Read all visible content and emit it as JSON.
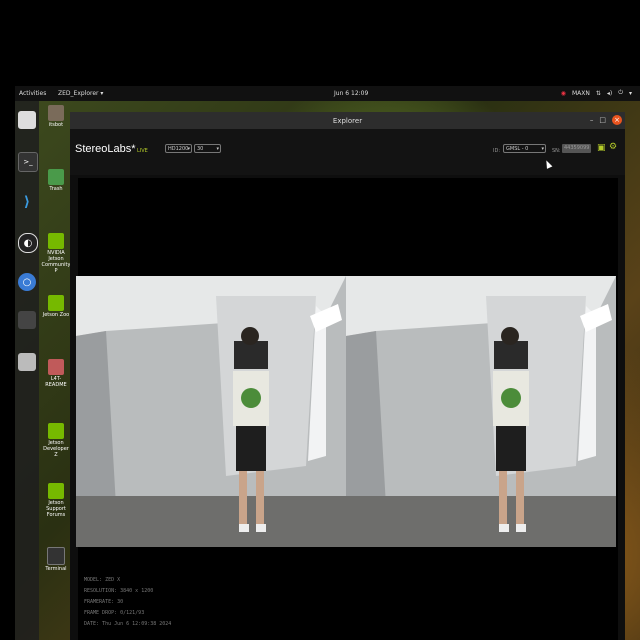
{
  "topbar": {
    "activities": "Activities",
    "app_menu": "ZED_Explorer ▾",
    "clock": "Jun 6 12:09",
    "power_mode": "MAXN",
    "nvidia_icon": "nvidia-icon",
    "network_icon": "network-icon",
    "volume_icon": "volume-icon",
    "power_icon": "power-icon"
  },
  "dock": {
    "items": [
      "files-icon",
      "terminal-icon",
      "vscode-icon",
      "obs-icon",
      "chromium-icon",
      "window-icon",
      "drive-icon"
    ]
  },
  "desktop": {
    "items": [
      {
        "label": "itsbot",
        "icon": "home-folder-icon"
      },
      {
        "label": "Trash",
        "icon": "trash-icon"
      },
      {
        "label": "NVIDIA Jetson Community P",
        "icon": "nvidia-icon"
      },
      {
        "label": "Jetson Zoo",
        "icon": "nvidia-icon"
      },
      {
        "label": "L4T-README",
        "icon": "folder-icon"
      },
      {
        "label": "Jetson Developer Z",
        "icon": "nvidia-icon"
      },
      {
        "label": "Jetson Support Forums",
        "icon": "nvidia-icon"
      },
      {
        "label": "Terminal",
        "icon": "terminal-icon"
      }
    ]
  },
  "window": {
    "title": "Explorer",
    "minimize": "–",
    "maximize": "□",
    "close": "×"
  },
  "toolbar": {
    "brand": "StereoLabs*",
    "mode": "LIVE",
    "resolution_value": "HD1200",
    "fps_value": "30",
    "id_label": "ID:",
    "device_value": "GMSL - 0",
    "sn_label": "SN:",
    "serial_value": "44359099",
    "record_icon": "record-icon",
    "settings_icon": "gear-icon"
  },
  "info": {
    "model": "MODEL: ZED X",
    "resolution": "RESOLUTION: 3840 x 1200",
    "framerate": "FRAMERATE: 30",
    "frame_drop": "FRAME DROP: 0/121/93",
    "date": "DATE: Thu Jun 6 12:09:38 2024"
  },
  "colors": {
    "accent": "#b5cc2a",
    "close": "#e9541f",
    "window_bg": "#0e0e0e",
    "topbar_bg": "#111111"
  }
}
